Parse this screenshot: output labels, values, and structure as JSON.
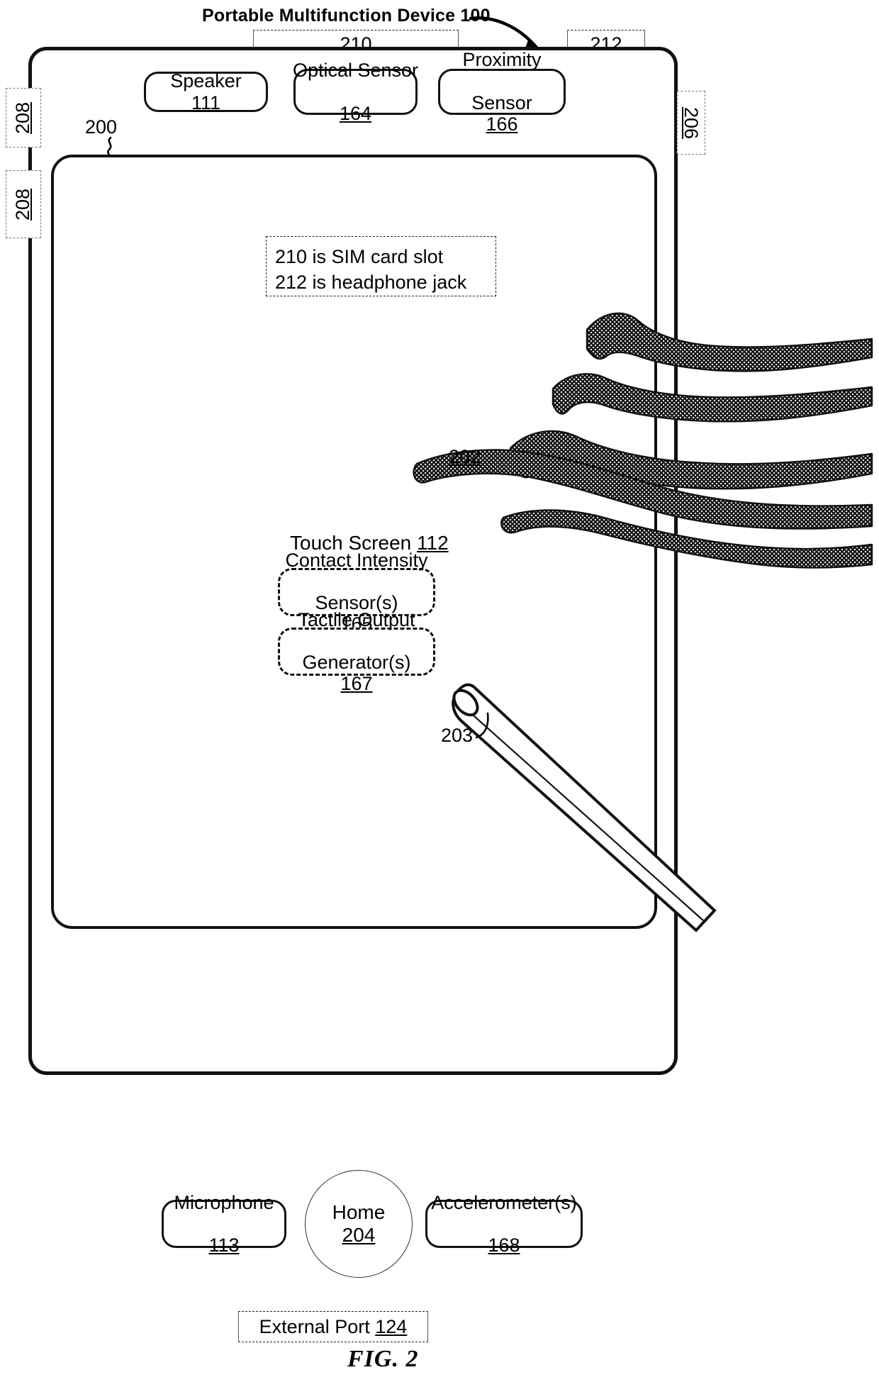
{
  "figure": {
    "title": "Portable Multifunction Device 100",
    "caption": "FIG. 2",
    "ref_device": "100"
  },
  "top_refs": {
    "sim_slot_ref": "210",
    "headphone_jack_ref": "212"
  },
  "side_refs": {
    "left_upper": "208",
    "left_lower": "208",
    "right": "206"
  },
  "screen_ref": {
    "label": "200"
  },
  "legend_note": {
    "line1": "210 is SIM card slot",
    "line2": "212 is headphone jack"
  },
  "top_components": [
    {
      "name": "speaker",
      "label": "Speaker",
      "ref": "111",
      "wrap": false
    },
    {
      "name": "optical-sensor",
      "label": "Optical Sensor",
      "ref": "164",
      "wrap": true
    },
    {
      "name": "proximity-sensor",
      "label": "Proximity\nSensor",
      "ref": "166",
      "wrap": true
    }
  ],
  "touch_screen": {
    "label": "Touch Screen",
    "ref": "112"
  },
  "screen_components": [
    {
      "name": "contact-intensity-sensor",
      "line1": "Contact Intensity",
      "line2": "Sensor(s)",
      "ref": "165"
    },
    {
      "name": "tactile-output-generator",
      "line1": "Tactile Output",
      "line2": "Generator(s)",
      "ref": "167"
    }
  ],
  "finger": {
    "ref": "202"
  },
  "stylus": {
    "ref": "203"
  },
  "bottom_components": [
    {
      "name": "microphone",
      "label": "Microphone",
      "ref": "113"
    },
    {
      "name": "accelerometer",
      "label": "Accelerometer(s)",
      "ref": "168"
    }
  ],
  "home_button": {
    "label": "Home",
    "ref": "204"
  },
  "external_port": {
    "label": "External Port",
    "ref": "124"
  },
  "colors": {
    "ink": "#000000",
    "paper": "#ffffff",
    "hatch": "#1a1a1a",
    "thin_rule": "#555555"
  }
}
